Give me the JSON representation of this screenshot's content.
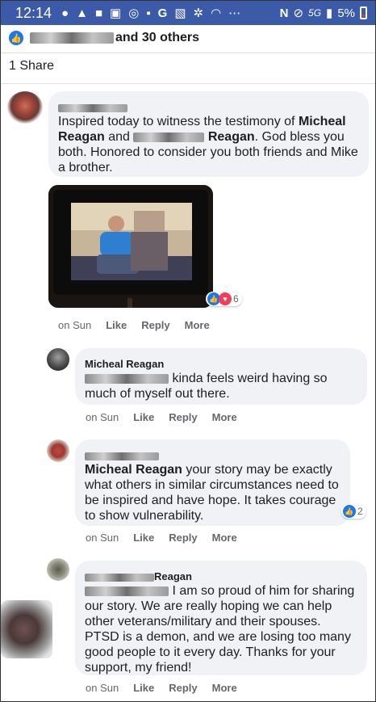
{
  "status": {
    "time": "12:14",
    "network": "5G",
    "battery": "5%"
  },
  "reactions": {
    "suffix": "and 30 others"
  },
  "shares": "1 Share",
  "comments": [
    {
      "text_a": "Inspired today to witness the testimony of ",
      "mention_a": "Micheal Reagan",
      "text_b": " and ",
      "mention_b": "Reagan",
      "text_c": ". God bless you both. Honored to consider you both friends and Mike a brother.",
      "reaction_count": "6",
      "when": "on Sun",
      "like": "Like",
      "reply": "Reply",
      "more": "More"
    },
    {
      "name": "Micheal Reagan",
      "text": " kinda feels weird having so much of myself out there.",
      "when": "on Sun",
      "like": "Like",
      "reply": "Reply",
      "more": "More"
    },
    {
      "mention": "Micheal Reagan",
      "text": " your story may be exactly what others in similar circumstances need to be inspired and have hope. It takes courage to show vulnerability.",
      "reaction_count": "2",
      "when": "on Sun",
      "like": "Like",
      "reply": "Reply",
      "more": "More"
    },
    {
      "name_suffix": "Reagan",
      "text": " I am so proud of him for sharing our story. We are really hoping we can help other veterans/military and their spouses. PTSD is a demon, and we are losing too many good people to it every day. Thanks for your support, my friend!",
      "when": "on Sun",
      "like": "Like",
      "reply": "Reply",
      "more": "More"
    }
  ]
}
